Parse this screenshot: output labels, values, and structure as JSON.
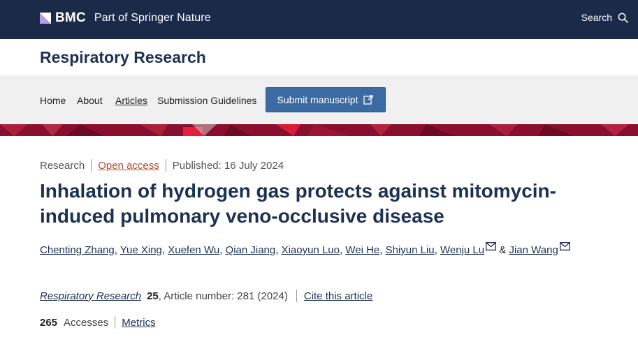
{
  "brand": {
    "name": "BMC",
    "tagline": "Part of Springer Nature"
  },
  "search": {
    "label": "Search",
    "icon": "search-icon"
  },
  "journal": {
    "title": "Respiratory Research"
  },
  "nav": {
    "items": [
      {
        "label": "Home"
      },
      {
        "label": "About"
      },
      {
        "label": "Articles",
        "current": true
      },
      {
        "label": "Submission Guidelines"
      }
    ],
    "submit_label": "Submit manuscript",
    "submit_icon": "external-link-icon"
  },
  "article": {
    "type": "Research",
    "access": "Open access",
    "published": "Published: 16 July 2024",
    "title": "Inhalation of hydrogen gas protects against mitomycin-induced pulmonary veno-occlusive disease",
    "authors": [
      "Chenting Zhang",
      "Yue Xing",
      "Xuefen Wu",
      "Qian Jiang",
      "Xiaoyun Luo",
      "Wei He",
      "Shiyun Liu",
      "Wenju Lu",
      "Jian Wang"
    ],
    "author_and": "&",
    "citation": {
      "journal": "Respiratory Research",
      "volume": "25",
      "rest": ", Article number: 281 (2024)",
      "cite_label": "Cite this article"
    },
    "metrics": {
      "accesses_count": "265",
      "accesses_label": "Accesses",
      "metrics_label": "Metrics"
    }
  },
  "colors": {
    "topbar": "#1c2a4a",
    "journal_title": "#1d3153",
    "submit": "#3c6aa2",
    "band": "#8a0f2e",
    "open_access": "#b24c2a"
  }
}
